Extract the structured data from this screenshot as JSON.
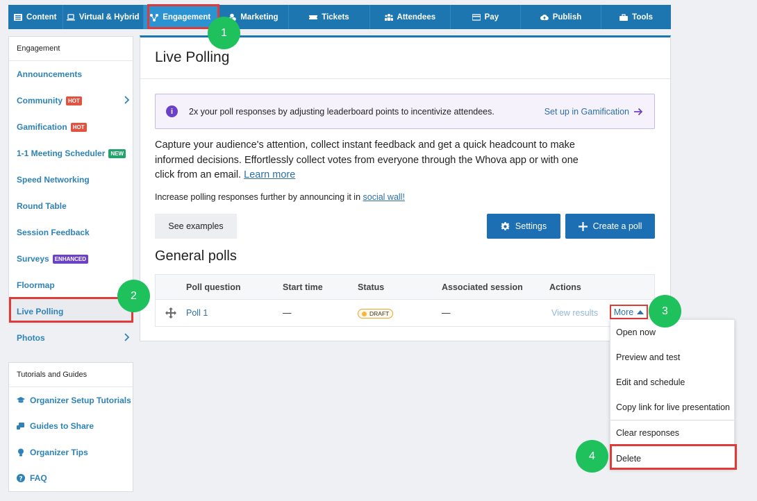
{
  "nav": [
    {
      "label": "Content",
      "icon": "content-icon"
    },
    {
      "label": "Virtual & Hybrid",
      "icon": "laptop-icon"
    },
    {
      "label": "Engagement",
      "icon": "engagement-icon"
    },
    {
      "label": "Marketing",
      "icon": "marketing-icon"
    },
    {
      "label": "Tickets",
      "icon": "ticket-icon"
    },
    {
      "label": "Attendees",
      "icon": "attendees-icon"
    },
    {
      "label": "Pay",
      "icon": "card-icon"
    },
    {
      "label": "Publish",
      "icon": "cloud-upload-icon"
    },
    {
      "label": "Tools",
      "icon": "toolbox-icon"
    }
  ],
  "sidebar": {
    "heading": "Engagement",
    "items": [
      {
        "label": "Announcements"
      },
      {
        "label": "Community",
        "badge": "HOT"
      },
      {
        "label": "Gamification",
        "badge": "HOT"
      },
      {
        "label": "1-1 Meeting Scheduler",
        "badge": "NEW"
      },
      {
        "label": "Speed Networking"
      },
      {
        "label": "Round Table"
      },
      {
        "label": "Session Feedback"
      },
      {
        "label": "Surveys",
        "badge": "ENHANCED"
      },
      {
        "label": "Floormap"
      },
      {
        "label": "Live Polling"
      },
      {
        "label": "Photos"
      }
    ]
  },
  "tutorials": {
    "heading": "Tutorials and Guides",
    "items": [
      {
        "label": "Organizer Setup Tutorials",
        "icon": "graduation-cap-icon"
      },
      {
        "label": "Guides to Share",
        "icon": "share-guide-icon"
      },
      {
        "label": "Organizer Tips",
        "icon": "lightbulb-icon"
      },
      {
        "label": "FAQ",
        "icon": "question-circle-icon"
      }
    ]
  },
  "main": {
    "title": "Live Polling",
    "info": {
      "icon": "i",
      "text": "2x your poll responses by adjusting leaderboard points to incentivize attendees.",
      "link": "Set up in Gamification"
    },
    "description": "Capture your audience's attention, collect instant feedback and get a quick headcount to make informed decisions. Effortlessly collect votes from everyone through the Whova app or with one click from an email.",
    "learn_more": "Learn more",
    "description2": "Increase polling responses further by announcing it in",
    "social_wall": "social wall!",
    "see_examples": "See examples",
    "settings": "Settings",
    "create_poll": "Create a poll",
    "section_title": "General polls",
    "table": {
      "headers": [
        "Poll question",
        "Start time",
        "Status",
        "Associated session",
        "Actions"
      ],
      "row": {
        "question": "Poll 1",
        "start_time": "—",
        "status": "DRAFT",
        "session": "—",
        "view_results": "View results",
        "more": "More"
      }
    }
  },
  "dropdown": [
    "Open now",
    "Preview and test",
    "Edit and schedule",
    "Copy link for live presentation",
    "Clear responses",
    "Delete"
  ],
  "annotations": [
    "1",
    "2",
    "3",
    "4"
  ],
  "colors": {
    "nav": "#1d76b0",
    "accent_red": "#e03b3b",
    "step_green": "#1ec15c",
    "link": "#2d82b7"
  }
}
